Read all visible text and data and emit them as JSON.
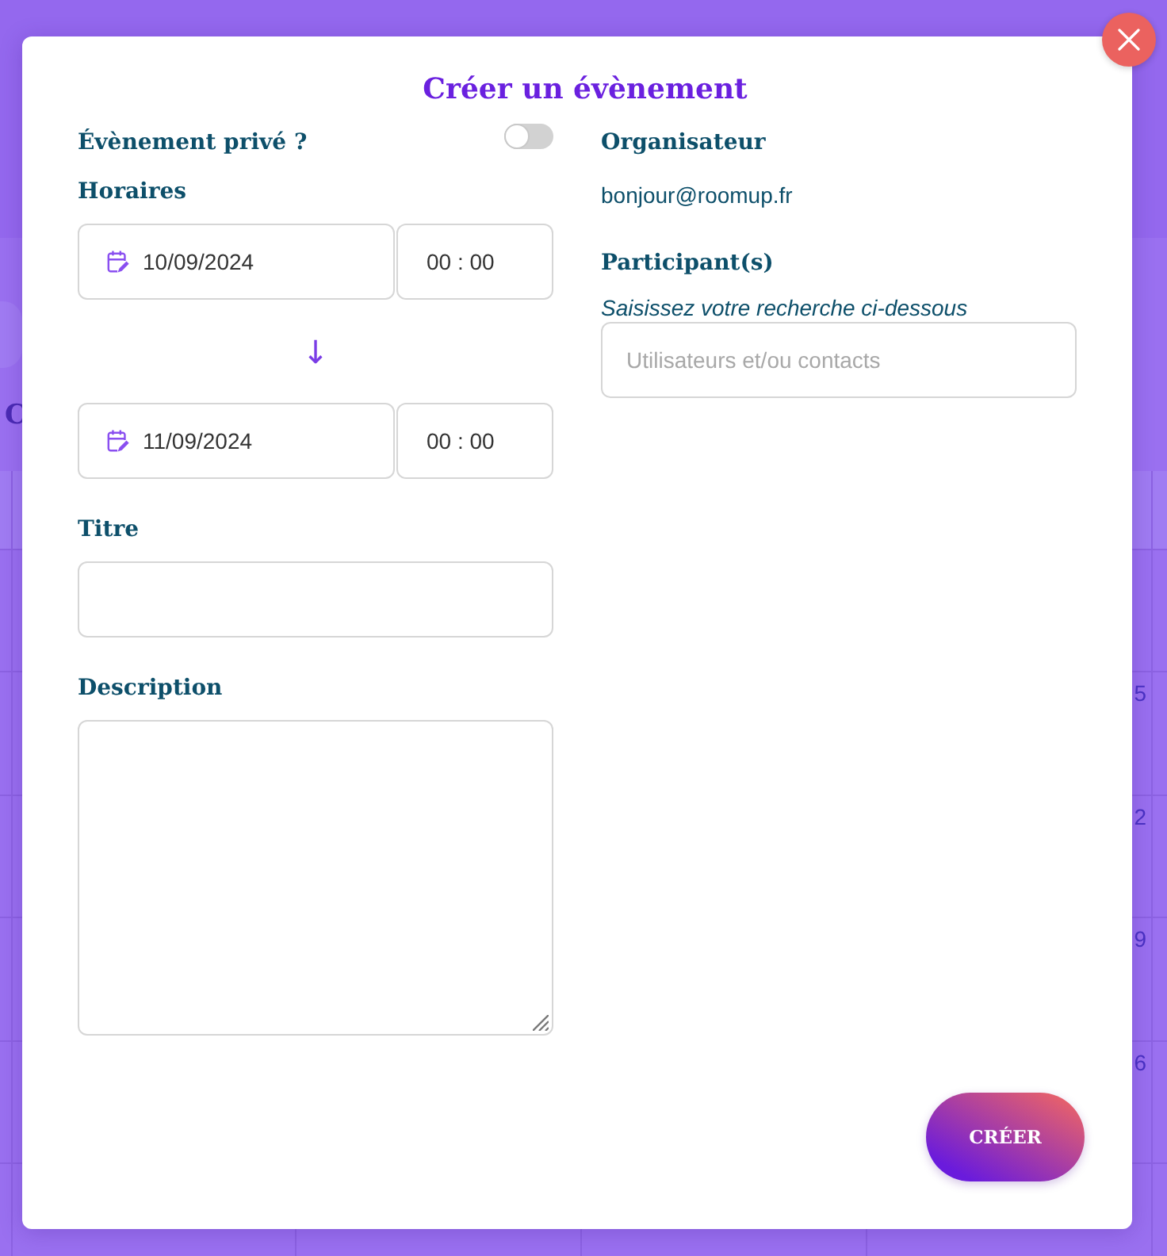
{
  "background_page": {
    "heading_fragment": "C",
    "day_numbers": [
      "5",
      "2",
      "9",
      "6"
    ]
  },
  "dialog": {
    "title": "Créer un évènement"
  },
  "private_event": {
    "label": "Évènement privé ?",
    "on": false
  },
  "schedule": {
    "label": "Horaires",
    "start": {
      "date": "10/09/2024",
      "time": "00 : 00"
    },
    "separator": "↓",
    "end": {
      "date": "11/09/2024",
      "time": "00 : 00"
    }
  },
  "title_field": {
    "label": "Titre"
  },
  "description_field": {
    "label": "Description"
  },
  "organizer": {
    "label": "Organisateur",
    "value": "bonjour@roomup.fr"
  },
  "participants": {
    "label": "Participant(s)",
    "hint": "Saisissez votre recherche ci-dessous",
    "placeholder": "Utilisateurs et/ou contacts"
  },
  "buttons": [
    {
      "label": "CRÉER"
    }
  ]
}
